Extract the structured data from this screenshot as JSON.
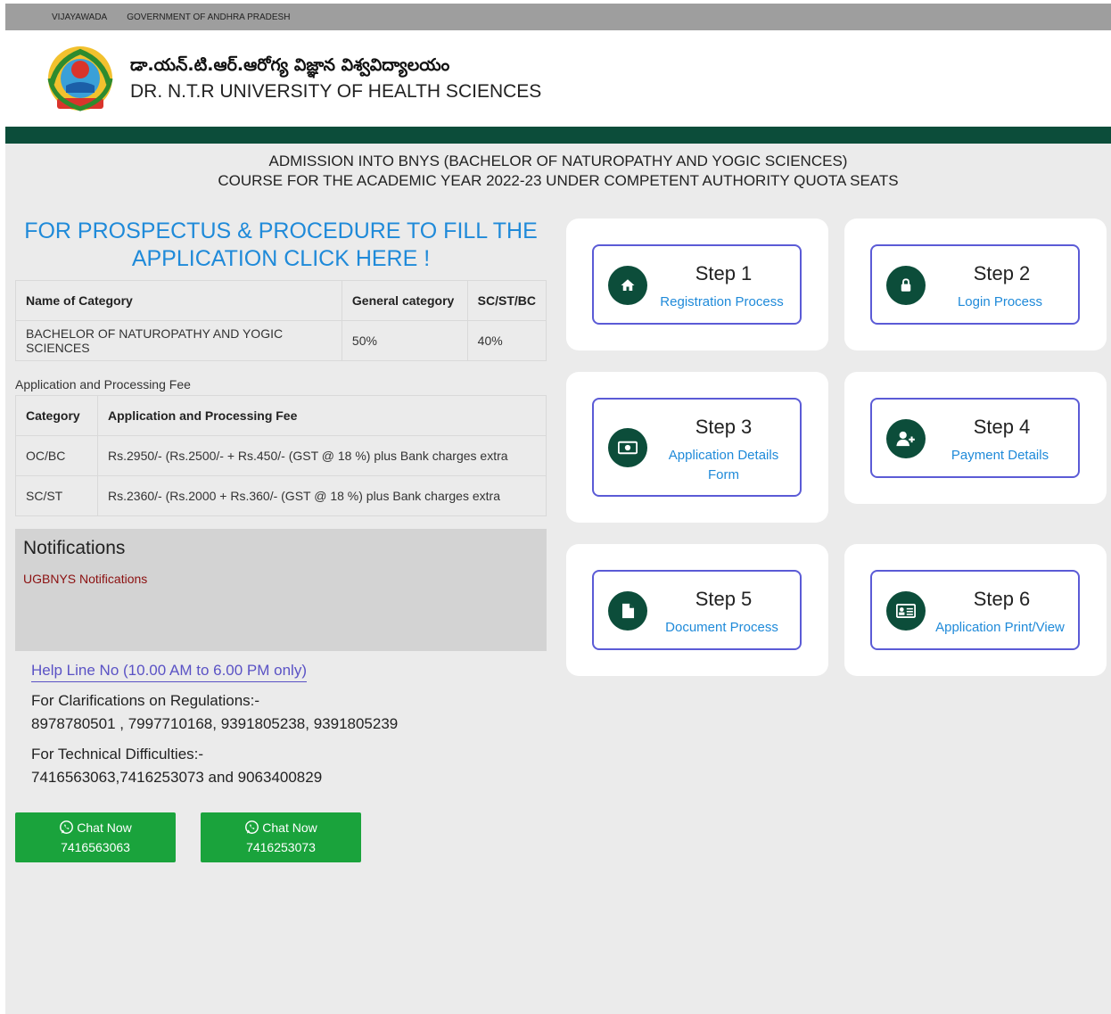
{
  "topbar": {
    "city": "VIJAYAWADA",
    "gov": "GOVERNMENT OF ANDHRA PRADESH"
  },
  "header": {
    "title_telugu": "డా.యన్.టి.ఆర్.ఆరోగ్య విజ్ఞాన విశ్వవిద్యాలయం",
    "title_english": "DR. N.T.R UNIVERSITY OF HEALTH SCIENCES",
    "logo_icon": "university-emblem-icon"
  },
  "admission": {
    "line1": "ADMISSION INTO BNYS (BACHELOR OF NATUROPATHY AND YOGIC SCIENCES)",
    "line2": "COURSE FOR THE ACADEMIC YEAR 2022-23 UNDER COMPETENT AUTHORITY QUOTA SEATS"
  },
  "prospectus": {
    "line1": "FOR PROSPECTUS & PROCEDURE TO FILL THE",
    "line2": "APPLICATION CLICK HERE !"
  },
  "category_table": {
    "headers": [
      "Name of Category",
      "General category",
      "SC/ST/BC"
    ],
    "rows": [
      [
        "BACHELOR OF NATUROPATHY AND YOGIC SCIENCES",
        "50%",
        "40%"
      ]
    ]
  },
  "fee": {
    "label": "Application and Processing Fee",
    "headers": [
      "Category",
      "Application and Processing Fee"
    ],
    "rows": [
      [
        "OC/BC",
        "Rs.2950/- (Rs.2500/- + Rs.450/- (GST @ 18 %) plus Bank charges extra"
      ],
      [
        "SC/ST",
        "Rs.2360/- (Rs.2000 + Rs.360/- (GST @ 18 %) plus Bank charges extra"
      ]
    ]
  },
  "notifications": {
    "title": "Notifications",
    "link": "UGBNYS Notifications"
  },
  "help": {
    "link": "Help Line No (10.00 AM to 6.00 PM only)",
    "regulations_label": "For Clarifications on Regulations:-",
    "regulations_numbers": "8978780501 , 7997710168, 9391805238, 9391805239",
    "technical_label": "For Technical Difficulties:-",
    "technical_numbers": "7416563063,7416253073 and 9063400829"
  },
  "chat": [
    {
      "label": "Chat Now",
      "number": "7416563063"
    },
    {
      "label": "Chat Now",
      "number": "7416253073"
    }
  ],
  "steps": [
    {
      "title": "Step 1",
      "desc": "Registration Process",
      "icon": "home-icon"
    },
    {
      "title": "Step 2",
      "desc": "Login Process",
      "icon": "lock-icon"
    },
    {
      "title": "Step 3",
      "desc": "Application Details Form",
      "icon": "money-icon"
    },
    {
      "title": "Step 4",
      "desc": "Payment Details",
      "icon": "add-user-icon"
    },
    {
      "title": "Step 5",
      "desc": "Document Process",
      "icon": "document-icon"
    },
    {
      "title": "Step 6",
      "desc": "Application Print/View",
      "icon": "id-card-icon"
    }
  ],
  "colors": {
    "accent_green": "#0c4d3a",
    "link_blue": "#1f8ad9",
    "step_border": "#5b5bd6",
    "chat_green": "#1aa33c",
    "notif_link": "#8b1010"
  }
}
